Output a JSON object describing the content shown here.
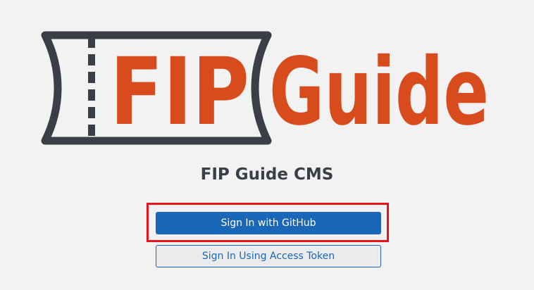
{
  "logo": {
    "word_left": "FIP",
    "word_right": "Guide",
    "text_color": "#d84b1d",
    "ticket_color": "#3a3f47"
  },
  "title": "FIP Guide CMS",
  "buttons": {
    "github_label": "Sign In with GitHub",
    "token_label": "Sign In Using Access Token"
  },
  "colors": {
    "primary": "#1a66b7",
    "highlight": "#e8141b",
    "background": "#f2f2f2"
  }
}
